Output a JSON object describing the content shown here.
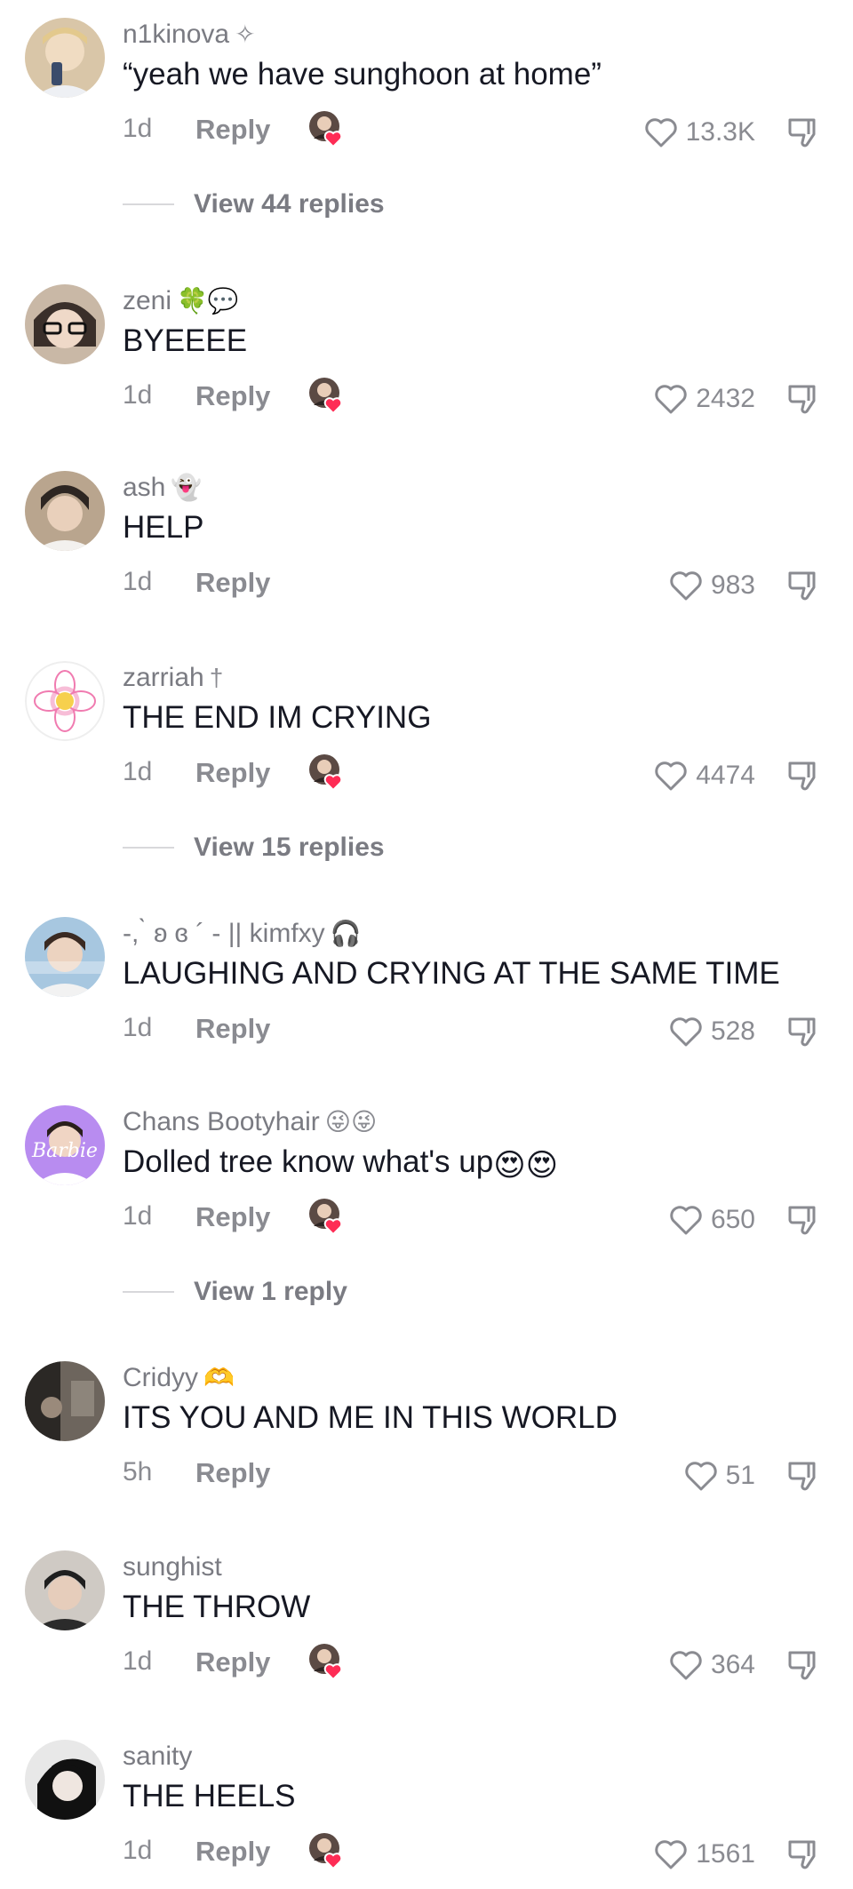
{
  "comments": [
    {
      "username": "n1kinova",
      "user_deco": "✧",
      "text": "“yeah we have sunghoon at home”",
      "time": "1d",
      "reply": "Reply",
      "creator_liked": true,
      "likes": "13.3K",
      "view_replies": "View 44 replies",
      "avatar_colors": [
        "#d9c6a8",
        "#3b4c6b"
      ]
    },
    {
      "username": "zeni",
      "user_deco": "🍀💬",
      "text": "BYEEEE",
      "time": "1d",
      "reply": "Reply",
      "creator_liked": true,
      "likes": "2432",
      "avatar_colors": [
        "#c9b8a6",
        "#2b2b2b"
      ]
    },
    {
      "username": "ash",
      "user_deco": "👻",
      "text": "HELP",
      "time": "1d",
      "reply": "Reply",
      "creator_liked": false,
      "likes": "983",
      "avatar_colors": [
        "#b9a58e",
        "#2d2622"
      ]
    },
    {
      "username": "zarriah",
      "user_deco": "†",
      "text": "THE END IM CRYING",
      "time": "1d",
      "reply": "Reply",
      "creator_liked": true,
      "likes": "4474",
      "view_replies": "View 15 replies",
      "avatar_colors": [
        "#ffffff",
        "#f07bb0"
      ]
    },
    {
      "username": "-, ̀ ʚ ɞ ´ -  || kimfxy",
      "user_deco": "🎧",
      "text": "LAUGHING AND CRYING AT THE SAME TIME",
      "time": "1d",
      "reply": "Reply",
      "creator_liked": false,
      "likes": "528",
      "avatar_colors": [
        "#a7c7e0",
        "#3a2a22"
      ]
    },
    {
      "username": "Chans Bootyhair",
      "user_deco": "😜😜",
      "text": "Dolled tree know what's up",
      "text_emoji": "😍😍",
      "time": "1d",
      "reply": "Reply",
      "creator_liked": true,
      "likes": "650",
      "view_replies": "View 1 reply",
      "avatar_colors": [
        "#b88cf0",
        "#ffffff"
      ]
    },
    {
      "username": "Cridyy",
      "user_deco": "🫶",
      "text": "ITS YOU AND ME IN THIS WORLD",
      "time": "5h",
      "reply": "Reply",
      "creator_liked": false,
      "likes": "51",
      "avatar_colors": [
        "#6d655d",
        "#2b2825"
      ]
    },
    {
      "username": "sunghist",
      "user_deco": "",
      "text": "THE THROW",
      "time": "1d",
      "reply": "Reply",
      "creator_liked": true,
      "likes": "364",
      "avatar_colors": [
        "#cfcac4",
        "#1f1f1f"
      ]
    },
    {
      "username": "sanity",
      "user_deco": "",
      "text": "THE HEELS",
      "time": "1d",
      "reply": "Reply",
      "creator_liked": true,
      "likes": "1561",
      "avatar_colors": [
        "#e8e8e8",
        "#111111"
      ]
    }
  ],
  "colors": {
    "text": "#161823",
    "muted": "#8a8b91",
    "heart_red": "#fe2c55"
  },
  "icons": {
    "like": "heart-outline-icon",
    "dislike": "thumbs-down-icon",
    "creator_liked": "creator-liked-heart-icon"
  }
}
